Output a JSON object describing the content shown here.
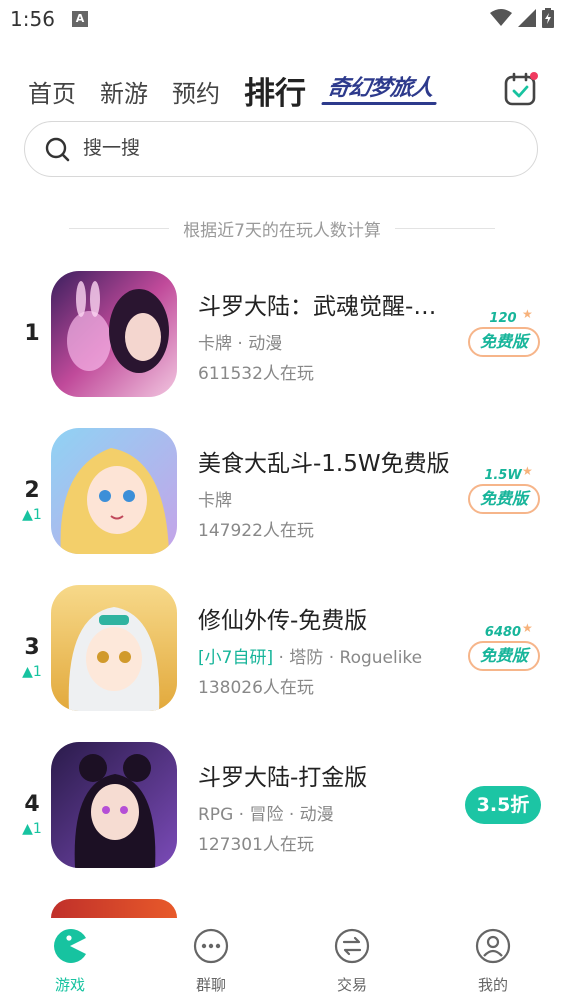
{
  "status_bar": {
    "time": "1:56",
    "notification_letter": "A"
  },
  "top_nav": {
    "tabs": [
      {
        "label": "首页"
      },
      {
        "label": "新游"
      },
      {
        "label": "预约"
      },
      {
        "label": "排行",
        "active": true
      }
    ],
    "brand_logo_text": "奇幻梦旅人"
  },
  "search": {
    "placeholder": "搜一搜"
  },
  "ranking_note": "根据近7天的在玩人数计算",
  "ranking": [
    {
      "rank": "1",
      "change": "",
      "title": "斗罗大陆：武魂觉醒-免费版",
      "self_tag": "",
      "tags": "卡牌 · 动漫",
      "players": "611532人在玩",
      "badge_type": "free",
      "badge_amount": "120",
      "badge_label": "免费版"
    },
    {
      "rank": "2",
      "change": "▲1",
      "title": "美食大乱斗-1.5W免费版",
      "self_tag": "",
      "tags": "卡牌",
      "players": "147922人在玩",
      "badge_type": "free",
      "badge_amount": "1.5W",
      "badge_label": "免费版"
    },
    {
      "rank": "3",
      "change": "▲1",
      "title": "修仙外传-免费版",
      "self_tag": "[小7自研]",
      "tags": " · 塔防 · Roguelike",
      "players": "138026人在玩",
      "badge_type": "free",
      "badge_amount": "6480",
      "badge_label": "免费版"
    },
    {
      "rank": "4",
      "change": "▲1",
      "title": "斗罗大陆-打金版",
      "self_tag": "",
      "tags": "RPG · 冒险 · 动漫",
      "players": "127301人在玩",
      "badge_type": "discount",
      "badge_label": "3.5折"
    }
  ],
  "bottom_nav": [
    {
      "label": "游戏",
      "icon": "pacman-icon",
      "active": true
    },
    {
      "label": "群聊",
      "icon": "chat-dots-icon"
    },
    {
      "label": "交易",
      "icon": "exchange-icon"
    },
    {
      "label": "我的",
      "icon": "user-icon"
    }
  ],
  "colors": {
    "accent": "#17c3a0",
    "badge_border": "#f6b58a",
    "brand": "#2d3a8c"
  }
}
